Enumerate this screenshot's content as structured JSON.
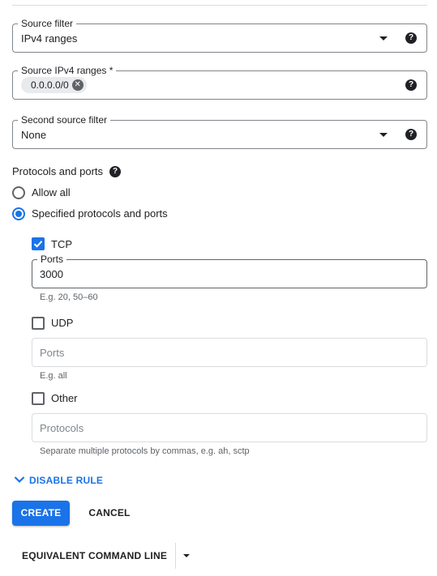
{
  "source_filter": {
    "label": "Source filter",
    "value": "IPv4 ranges"
  },
  "source_ipv4_ranges": {
    "label": "Source IPv4 ranges *",
    "chips": [
      "0.0.0.0/0"
    ]
  },
  "second_source_filter": {
    "label": "Second source filter",
    "value": "None"
  },
  "protocols": {
    "title": "Protocols and ports",
    "options": {
      "allow_all": "Allow all",
      "specified": "Specified protocols and ports"
    },
    "selected": "specified",
    "tcp": {
      "label": "TCP",
      "checked": true,
      "ports_label": "Ports",
      "ports_value": "3000",
      "hint": "E.g. 20, 50–60"
    },
    "udp": {
      "label": "UDP",
      "checked": false,
      "ports_placeholder": "Ports",
      "hint": "E.g. all"
    },
    "other": {
      "label": "Other",
      "checked": false,
      "protocols_placeholder": "Protocols",
      "hint": "Separate multiple protocols by commas, e.g. ah, sctp"
    }
  },
  "disable_rule_label": "DISABLE RULE",
  "actions": {
    "create": "CREATE",
    "cancel": "CANCEL"
  },
  "equivalent_command_line": "EQUIVALENT COMMAND LINE",
  "help_glyph": "?",
  "chip_close_glyph": "✕",
  "colors": {
    "accent": "#1a73e8",
    "text": "#202124",
    "hint": "#5f6368",
    "border": "#80868b"
  }
}
